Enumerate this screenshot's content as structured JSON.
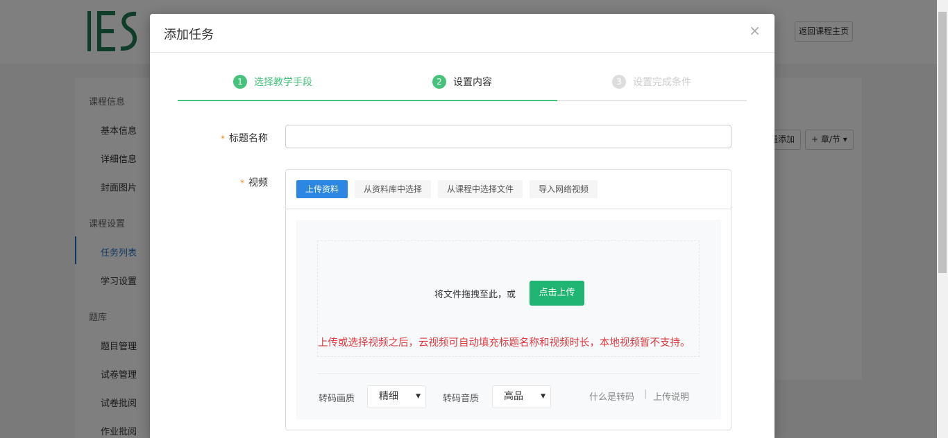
{
  "background": {
    "back_button": "返回课程主页",
    "sidebar": {
      "groups": [
        "课程信息",
        "课程设置",
        "题库"
      ],
      "items": [
        "基本信息",
        "详细信息",
        "封面图片",
        "任务列表",
        "学习设置",
        "题目管理",
        "试卷管理",
        "试卷批阅",
        "作业批阅"
      ],
      "active_item": "任务列表"
    },
    "toolbar": {
      "batch_add": "量添加",
      "chapter": "+ 章/节 ▾"
    }
  },
  "modal": {
    "title": "添加任务",
    "close_icon": "×",
    "steps": [
      {
        "num": "1",
        "label": "选择教学手段",
        "state": "done"
      },
      {
        "num": "2",
        "label": "设置内容",
        "state": "current"
      },
      {
        "num": "3",
        "label": "设置完成条件",
        "state": "todo"
      }
    ],
    "title_field": {
      "required_mark": "*",
      "label": "标题名称",
      "value": ""
    },
    "video_field": {
      "required_mark": "*",
      "label": "视频",
      "tabs": [
        "上传资料",
        "从资料库中选择",
        "从课程中选择文件",
        "导入网络视频"
      ],
      "active_tab": "上传资料",
      "drop_text": "将文件拖拽至此，或",
      "upload_button": "点击上传",
      "tip": "上传或选择视频之后，云视频可自动填充标题名称和视频时长，本地视频暂不支持。",
      "video_quality_label": "转码画质",
      "video_quality_value": "精细",
      "audio_quality_label": "转码音质",
      "audio_quality_value": "高品",
      "help_link": "什么是转码",
      "separator": "|",
      "upload_help_link": "上传说明"
    }
  },
  "colors": {
    "accent_green": "#46c37b",
    "upload_green": "#20b573",
    "tab_blue": "#2b87e3",
    "warning_red": "#e0393e"
  }
}
